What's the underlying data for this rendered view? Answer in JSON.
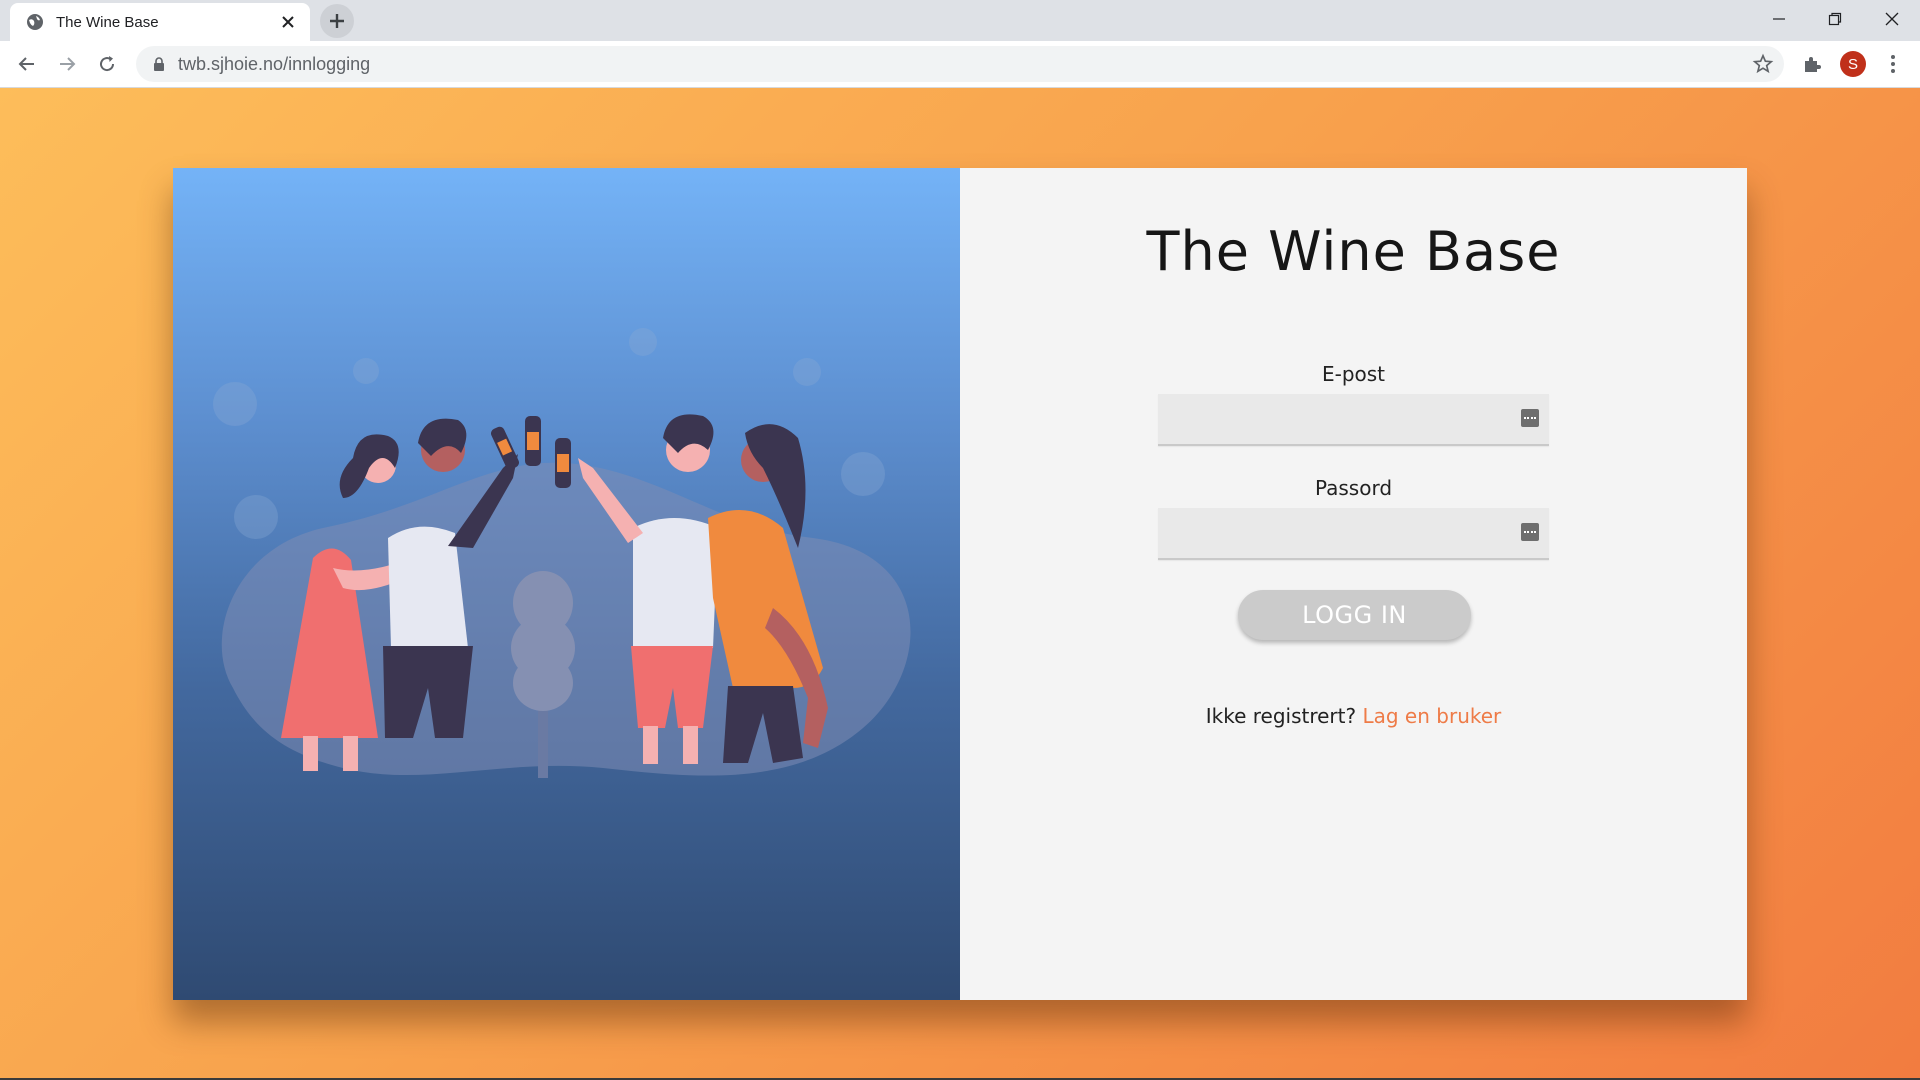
{
  "browser": {
    "tab_title": "The Wine Base",
    "url": "twb.sjhoie.no/innlogging",
    "profile_initial": "S"
  },
  "page": {
    "title": "The Wine Base",
    "email_label": "E-post",
    "email_value": "",
    "password_label": "Passord",
    "password_value": "",
    "login_button": "LOGG IN",
    "register_prompt": "Ikke registrert?",
    "register_link": "Lag en bruker"
  },
  "colors": {
    "background_gradient": [
      "#fdbd5a",
      "#f27c40"
    ],
    "illustration_gradient": [
      "#74b3f7",
      "#2f4a72"
    ],
    "link_accent": "#ee7b47",
    "button_bg": "#cbcbcb"
  },
  "icons": [
    "globe-icon",
    "close-icon",
    "plus-icon",
    "minimize-icon",
    "restore-icon",
    "back-icon",
    "forward-icon",
    "reload-icon",
    "lock-icon",
    "star-icon",
    "extensions-icon",
    "menu-icon",
    "key-icon"
  ]
}
